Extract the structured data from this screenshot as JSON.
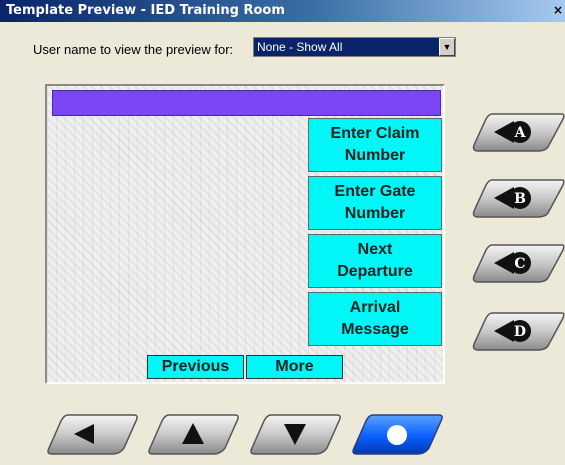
{
  "window": {
    "title": "Template Preview - IED Training Room",
    "close_glyph": "×"
  },
  "user_select": {
    "label": "User name to view the preview for:",
    "value": "None - Show All",
    "arrow_glyph": "▼"
  },
  "screen": {
    "header_color": "#7b47f5",
    "menu_buttons": [
      {
        "label": "Enter Claim\nNumber"
      },
      {
        "label": "Enter Gate\nNumber"
      },
      {
        "label": "Next\nDeparture"
      },
      {
        "label": "Arrival\nMessage"
      }
    ],
    "nav": {
      "previous_label": "Previous",
      "more_label": "More"
    },
    "button_color": "#00f7f7"
  },
  "side_buttons": [
    {
      "letter": "A",
      "icon": "circle-a-icon"
    },
    {
      "letter": "B",
      "icon": "circle-b-icon"
    },
    {
      "letter": "C",
      "icon": "circle-c-icon"
    },
    {
      "letter": "D",
      "icon": "circle-d-icon"
    }
  ],
  "bottom_buttons": [
    {
      "icon": "arrow-left-icon"
    },
    {
      "icon": "arrow-up-icon"
    },
    {
      "icon": "arrow-down-icon"
    },
    {
      "icon": "select-circle-icon",
      "active": true,
      "active_color": "#0a60ff"
    }
  ]
}
